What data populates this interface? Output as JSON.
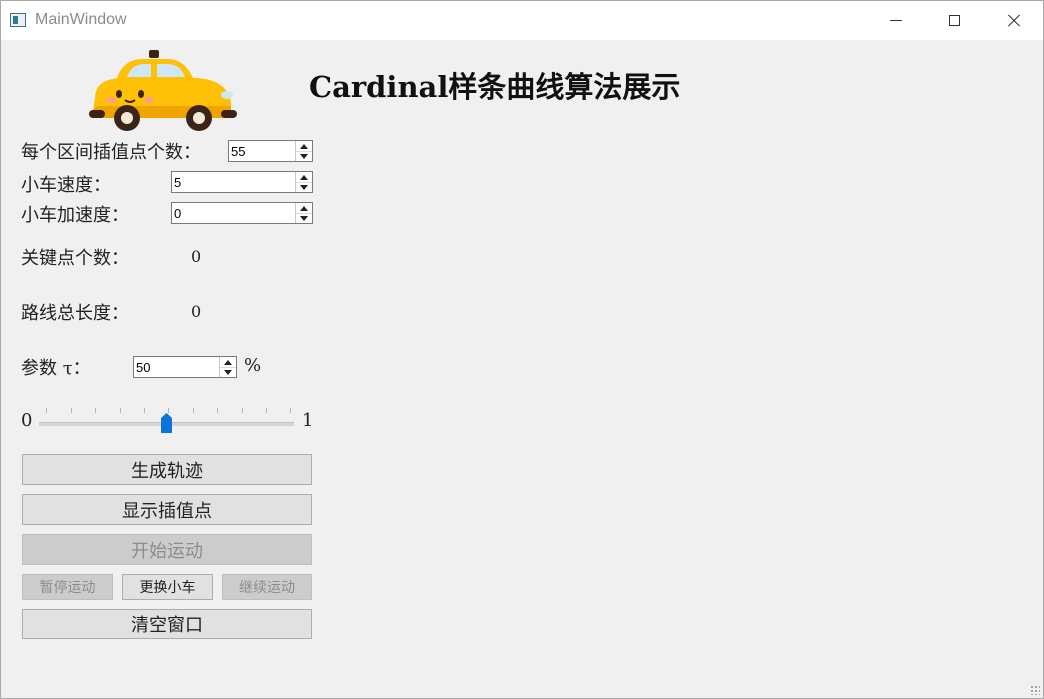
{
  "window": {
    "title": "MainWindow"
  },
  "heading": "Cardinal样条曲线算法展示",
  "settings": {
    "interp_points_label": "每个区间插值点个数：",
    "interp_points_value": "55",
    "car_speed_label": "小车速度：",
    "car_speed_value": "5",
    "car_accel_label": "小车加速度：",
    "car_accel_value": "0"
  },
  "stats": {
    "key_points_label": "关键点个数：",
    "key_points_value": "0",
    "route_length_label": "路线总长度：",
    "route_length_value": "0"
  },
  "tau": {
    "label": "参数 τ：",
    "value": "50",
    "unit": "%",
    "slider_min": "0",
    "slider_max": "1",
    "slider_fraction": 0.5
  },
  "buttons": {
    "generate": "生成轨迹",
    "show_points": "显示插值点",
    "start": "开始运动",
    "pause": "暂停运动",
    "change_car": "更换小车",
    "resume": "继续运动",
    "clear": "清空窗口"
  },
  "icons": {
    "window_icon": "app-window-icon",
    "car_image": "taxi-car-icon"
  },
  "colors": {
    "slider_thumb": "#0a74d8",
    "car_body": "#ffc107",
    "disabled_text": "#8c8c8c"
  }
}
